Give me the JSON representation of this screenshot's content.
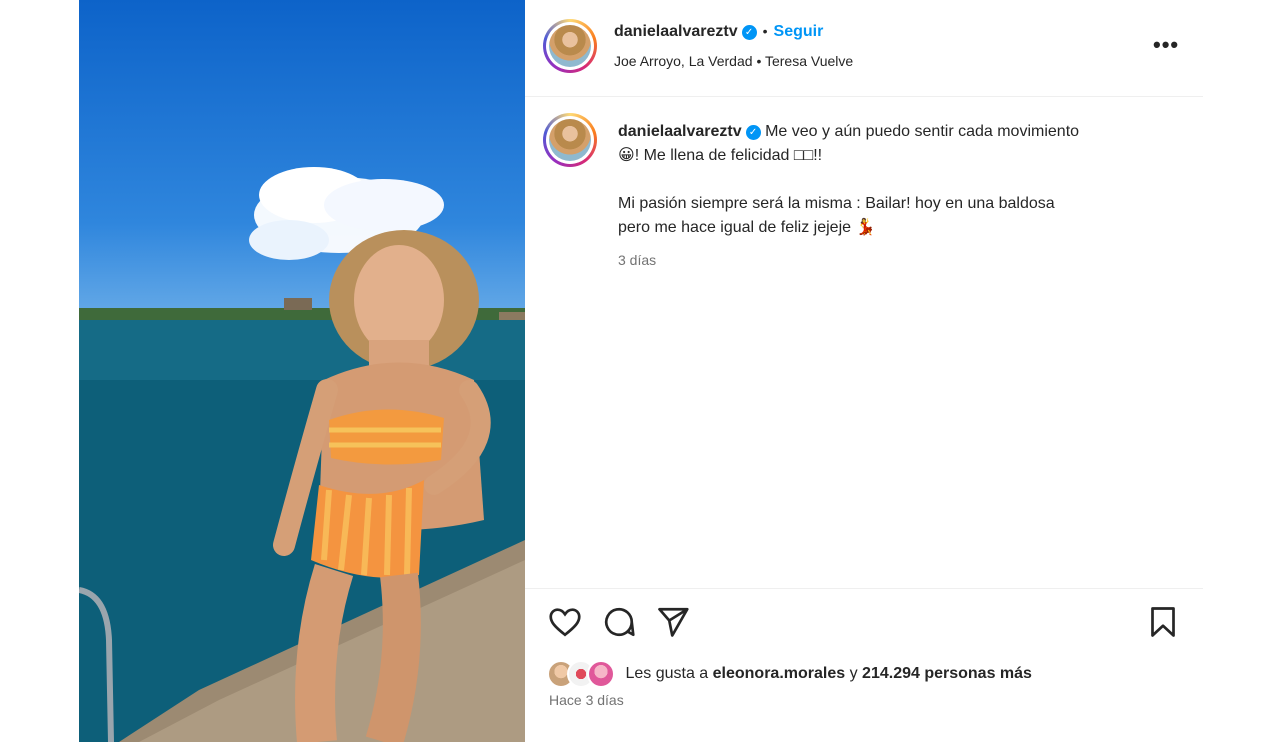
{
  "post": {
    "username": "danielaalvareztv",
    "verified_mark": "✓",
    "separator": "•",
    "follow_label": "Seguir",
    "audio": "Joe Arroyo, La Verdad",
    "audio_separator": "•",
    "audio_extra": "Teresa Vuelve",
    "more_label": "•••"
  },
  "caption": {
    "username": "danielaalvareztv",
    "line1": "Me veo y aún puedo sentir cada movimiento",
    "line2_emoji": "😀",
    "line2_text": "! Me llena de felicidad □□!!",
    "para2_line1": "Mi pasión siempre será la misma : Bailar! hoy en una baldosa",
    "para2_line2": "pero me hace igual de feliz jejeje",
    "para2_emoji": "💃",
    "time": "3 días"
  },
  "actions": {
    "icons": [
      "heart-icon",
      "comment-icon",
      "share-icon",
      "bookmark-icon"
    ]
  },
  "likes": {
    "prefix": "Les gusta a",
    "user": "eleonora.morales",
    "connector": "y",
    "count_text": "214.294 personas más"
  },
  "footer": {
    "ago": "Hace 3 días"
  },
  "colors": {
    "accent": "#0095f6",
    "text": "#262626",
    "muted": "#737373"
  }
}
